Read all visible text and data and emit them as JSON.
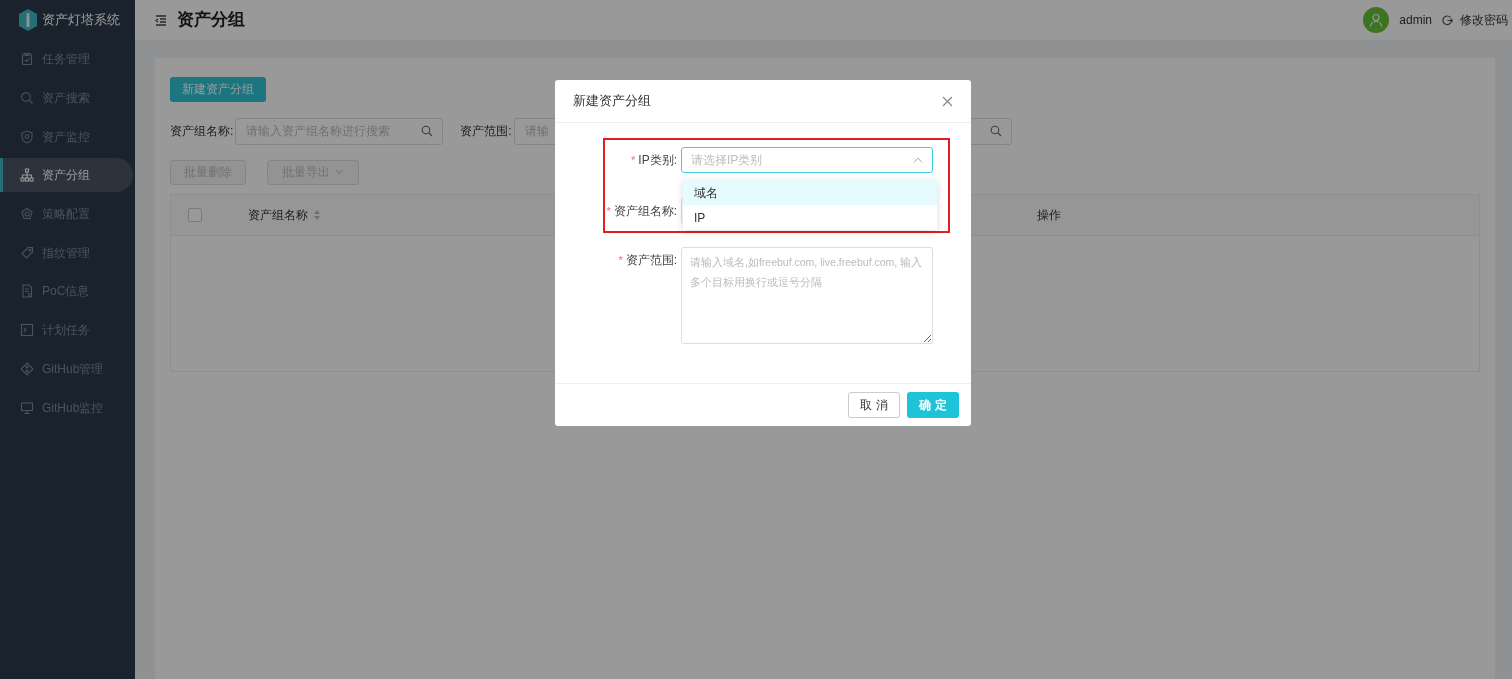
{
  "brand": {
    "title": "资产灯塔系统"
  },
  "sidebar": {
    "items": [
      {
        "label": "任务管理",
        "selected": false
      },
      {
        "label": "资产搜索",
        "selected": false
      },
      {
        "label": "资产监控",
        "selected": false
      },
      {
        "label": "资产分组",
        "selected": true
      },
      {
        "label": "策略配置",
        "selected": false
      },
      {
        "label": "指纹管理",
        "selected": false
      },
      {
        "label": "PoC信息",
        "selected": false
      },
      {
        "label": "计划任务",
        "selected": false
      },
      {
        "label": "GitHub管理",
        "selected": false
      },
      {
        "label": "GitHub监控",
        "selected": false
      }
    ]
  },
  "header": {
    "title": "资产分组",
    "user": "admin",
    "change_password": "修改密码"
  },
  "toolbar": {
    "new_button": "新建资产分组",
    "filters": [
      {
        "label": "资产组名称:",
        "placeholder": "请输入资产组名称进行搜索"
      },
      {
        "label": "资产范围:",
        "placeholder": "请输"
      }
    ],
    "batch_delete": "批量删除",
    "batch_export": "批量导出"
  },
  "table": {
    "select_all": {
      "checked": false
    },
    "columns": [
      {
        "label": "资产组名称",
        "sortable": true
      },
      {
        "label": "操作",
        "sortable": false
      }
    ]
  },
  "dialog": {
    "title": "新建资产分组",
    "fields": [
      {
        "kind": "select",
        "required_mark": "*",
        "label": "IP类别:",
        "placeholder": "请选择IP类别",
        "expanded": true,
        "options": [
          {
            "label": "域名",
            "selected": true
          },
          {
            "label": "IP",
            "selected": false
          }
        ]
      },
      {
        "kind": "input",
        "required_mark": "*",
        "label": "资产组名称:"
      },
      {
        "kind": "textarea",
        "required_mark": "*",
        "label": "资产范围:",
        "placeholder": "请输入域名,如freebuf.com, live.freebuf.com, 输入多个目标用换行或逗号分隔"
      }
    ],
    "buttons": [
      {
        "label": "取 消",
        "primary": false
      },
      {
        "label": "确 定",
        "primary": true
      }
    ]
  }
}
